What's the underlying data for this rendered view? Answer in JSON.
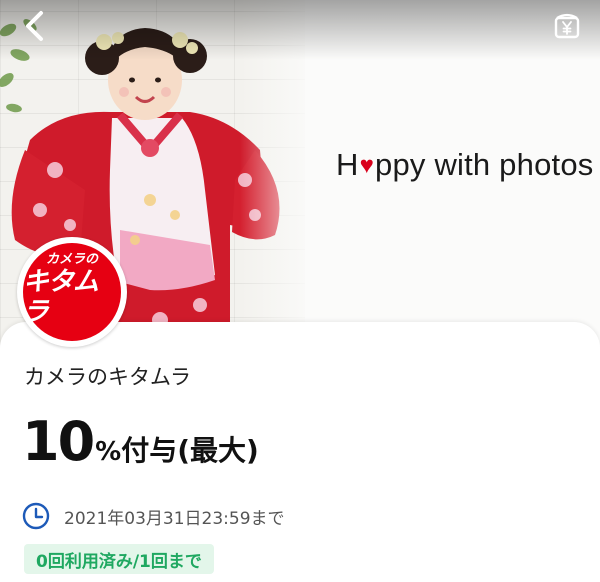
{
  "header": {
    "back_icon": "chevron-left-icon",
    "wallet_icon": "yen-wallet-icon"
  },
  "hero": {
    "tagline_before": "H",
    "tagline_heart": "♥",
    "tagline_after": "ppy with photos",
    "logo_top": "カメラの",
    "logo_main": "キタムラ"
  },
  "store": {
    "name": "カメラのキタムラ"
  },
  "reward": {
    "rate": "10",
    "unit": "%",
    "text": "付与(最大)"
  },
  "deadline": {
    "icon": "clock-icon",
    "text": "2021年03月31日23:59まで"
  },
  "usage": {
    "text": "0回利用済み/1回まで"
  },
  "colors": {
    "brand_red": "#e60012",
    "usage_green": "#1fa861",
    "usage_bg": "#e3f6ea",
    "accent_blue": "#1d5ab8"
  }
}
